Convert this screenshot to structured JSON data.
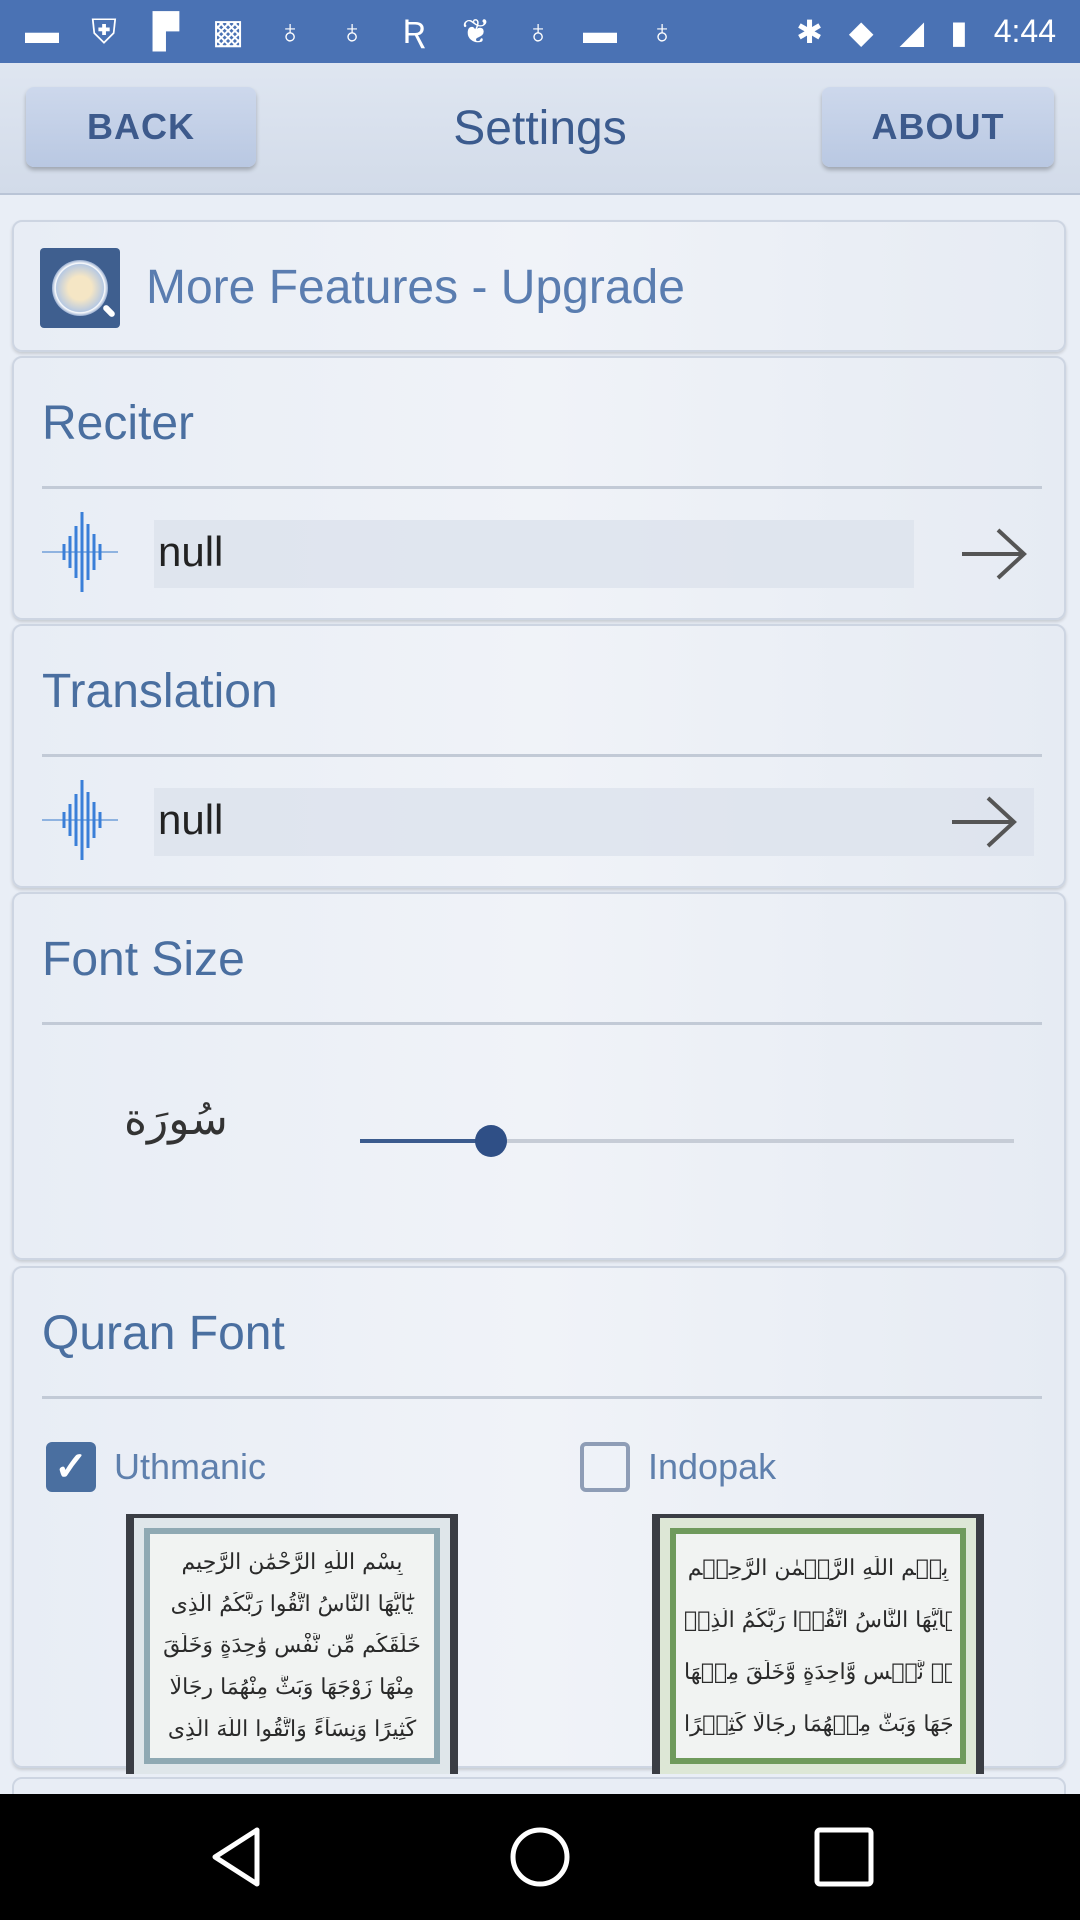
{
  "status_bar": {
    "time": "4:44",
    "left_icons": [
      "chat-icon",
      "shield-icon",
      "flipboard-icon",
      "game-icon",
      "bulb-icon",
      "bulb-icon",
      "r-icon",
      "bird-icon",
      "bulb-icon",
      "blank-icon",
      "bulb-icon"
    ],
    "right_icons": [
      "bluetooth-icon",
      "wifi-icon",
      "signal-icon",
      "battery-icon"
    ]
  },
  "header": {
    "back_label": "BACK",
    "title": "Settings",
    "about_label": "ABOUT"
  },
  "upgrade": {
    "label": "More Features - Upgrade"
  },
  "reciter": {
    "title": "Reciter",
    "value": "null"
  },
  "translation": {
    "title": "Translation",
    "value": "null"
  },
  "font_size": {
    "title": "Font Size",
    "sample_glyph": "سُورَة",
    "slider_value": 0.2
  },
  "quran_font": {
    "title": "Quran Font",
    "options": [
      {
        "label": "Uthmanic",
        "checked": true
      },
      {
        "label": "Indopak",
        "checked": false
      }
    ],
    "uthmanic_preview_lines": [
      "بِسْمِ اللَّهِ الرَّحْمَٰنِ الرَّحِيمِ",
      "يَٰٓأَيُّهَا النَّاسُ اتَّقُوا رَبَّكُمُ الَّذِى",
      "خَلَقَكُم مِّن نَّفْسٍ وَٰحِدَةٍ وَخَلَقَ",
      "مِنْهَا زَوْجَهَا وَبَثَّ مِنْهُمَا رِجَالًا",
      "كَثِيرًا وَنِسَآءً وَاتَّقُوا اللَّهَ الَّذِى"
    ],
    "indopak_preview_lines": [
      "بِسۡمِ اللّٰهِ الرَّحۡمٰنِ الرَّحِيۡمِ",
      "يٰۤاَيُّهَا النَّاسُ اتَّقُوۡا رَبَّكُمُ الَّذِىۡ",
      "خَلَقَكُمۡ مِّنۡ نَّفۡسٍ وَّاحِدَةٍ وَّخَلَقَ مِنۡهَا",
      "زَوۡجَهَا وَبَثَّ مِنۡهُمَا رِجَالًا كَثِيۡرًا"
    ]
  },
  "colors": {
    "status_bar": "#4a72b4",
    "accent": "#4a6fa0",
    "title_text": "#3b5b8e"
  }
}
